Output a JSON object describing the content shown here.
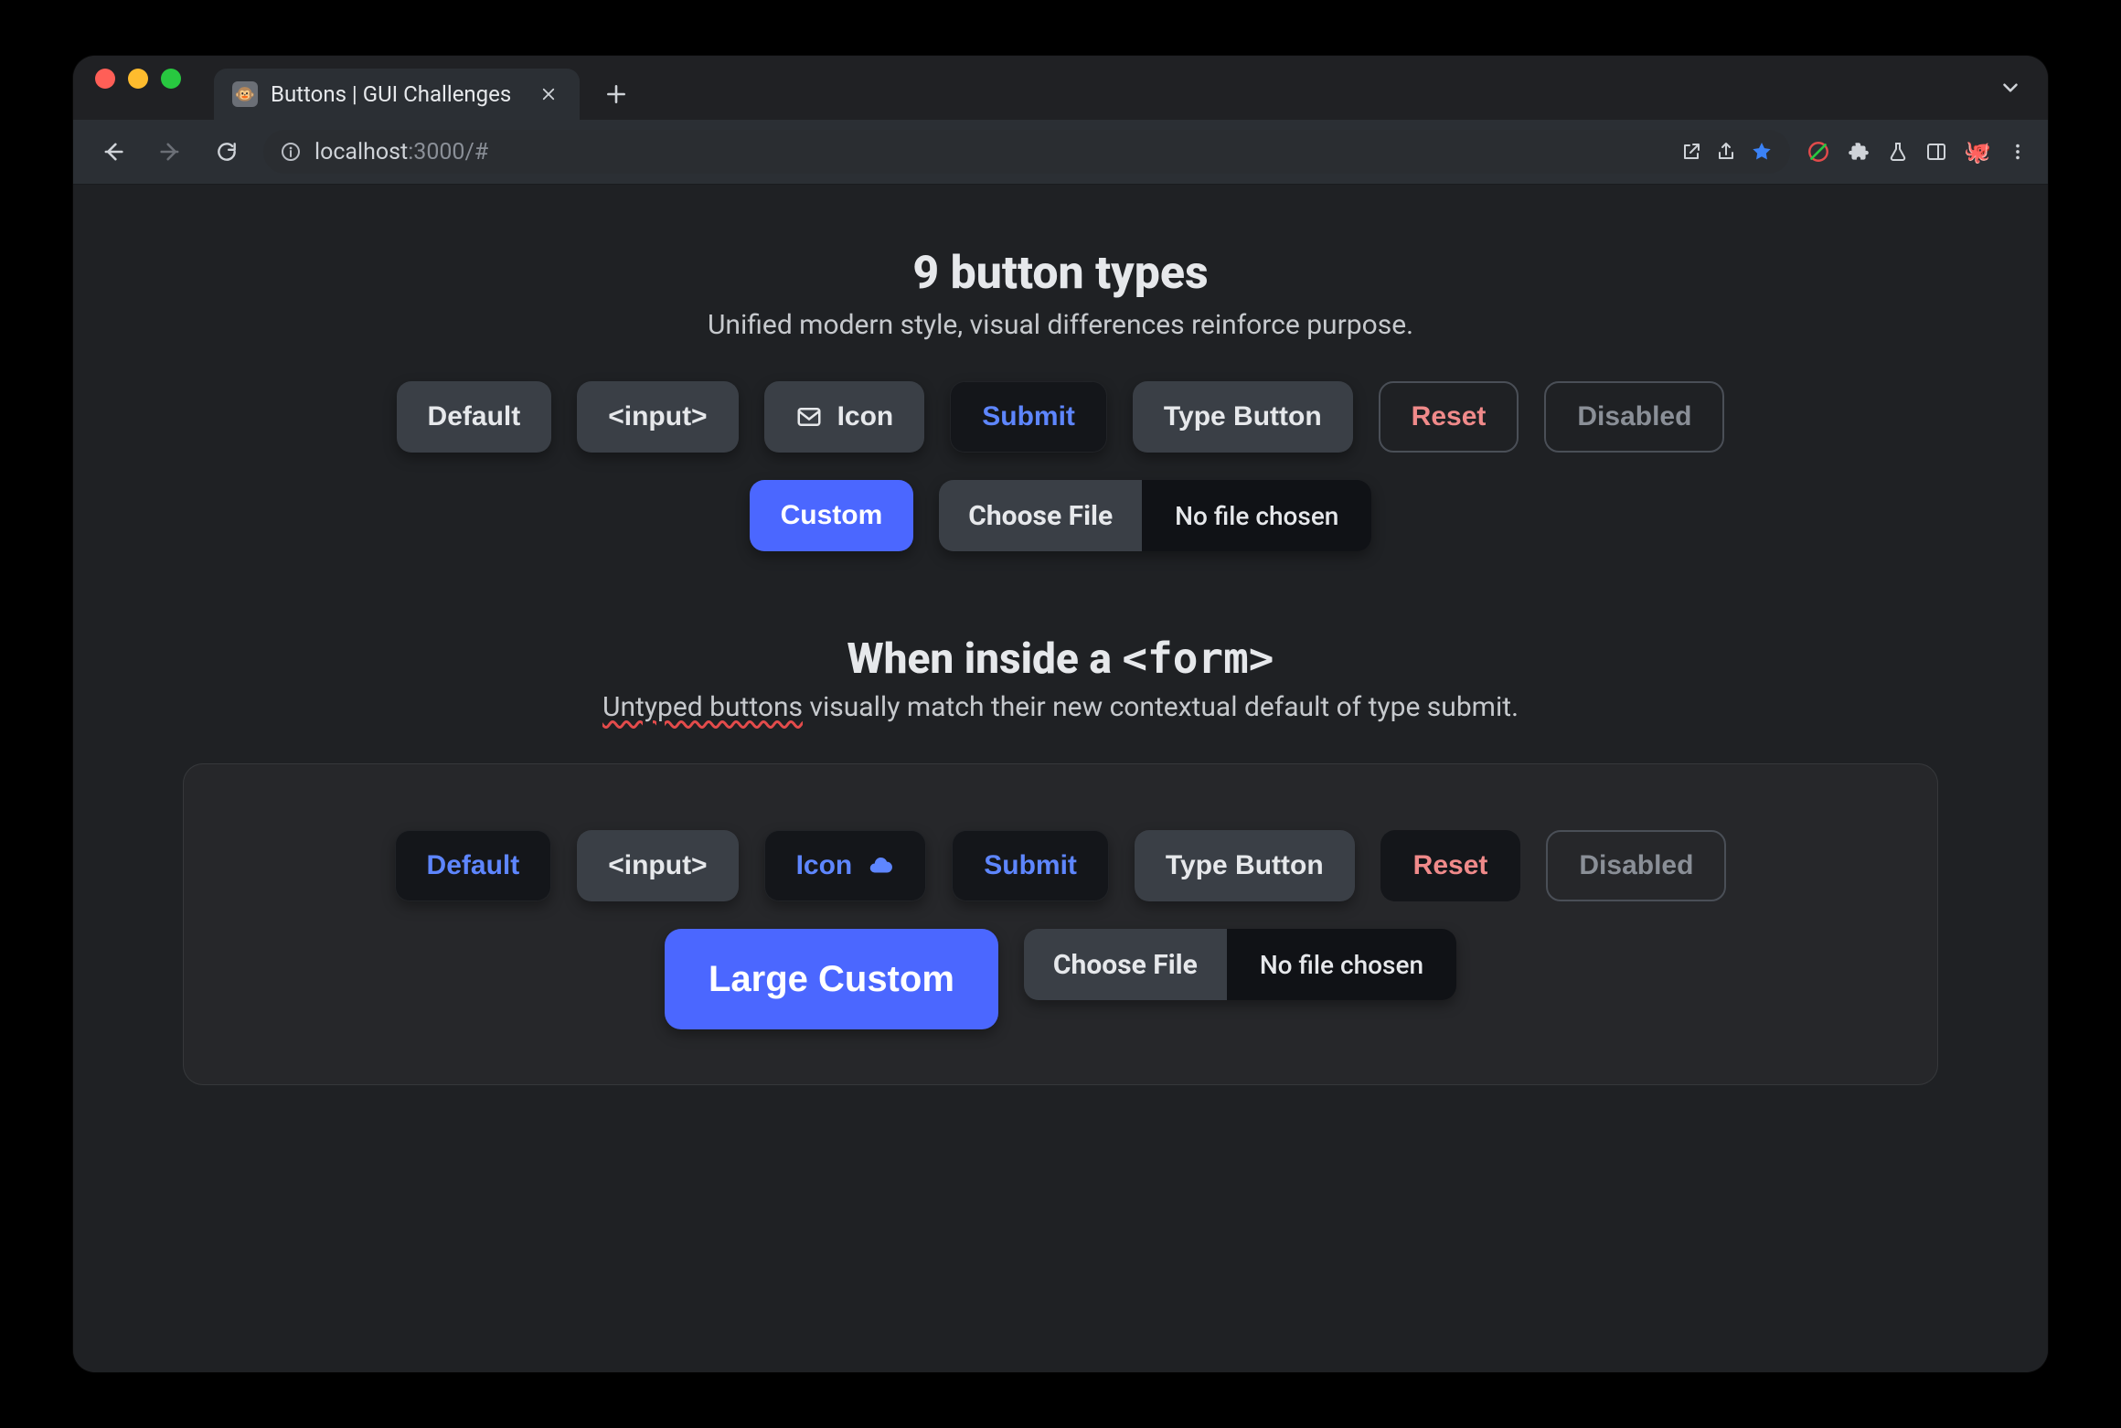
{
  "browser": {
    "tab_title": "Buttons | GUI Challenges",
    "url": {
      "host": "localhost",
      "port_path": ":3000/#"
    }
  },
  "section1": {
    "heading": "9 button types",
    "subtitle": "Unified modern style, visual differences reinforce purpose.",
    "buttons": {
      "default": "Default",
      "input": "<input>",
      "icon": "Icon",
      "submit": "Submit",
      "type_button": "Type Button",
      "reset": "Reset",
      "disabled": "Disabled",
      "custom": "Custom"
    },
    "file": {
      "button": "Choose File",
      "label": "No file chosen"
    }
  },
  "section2": {
    "heading_prefix": "When inside a ",
    "heading_code": "<form>",
    "subtitle_marked": "Untyped buttons",
    "subtitle_rest": " visually match their new contextual default of type submit.",
    "buttons": {
      "default": "Default",
      "input": "<input>",
      "icon": "Icon",
      "submit": "Submit",
      "type_button": "Type Button",
      "reset": "Reset",
      "disabled": "Disabled",
      "large_custom": "Large Custom"
    },
    "file": {
      "button": "Choose File",
      "label": "No file chosen"
    }
  },
  "icons": {
    "mail": "mail-icon",
    "cloud": "cloud-icon"
  },
  "colors": {
    "accent": "#4b67ff",
    "submit_text": "#5e86ff",
    "reset_text": "#f08a8a"
  }
}
